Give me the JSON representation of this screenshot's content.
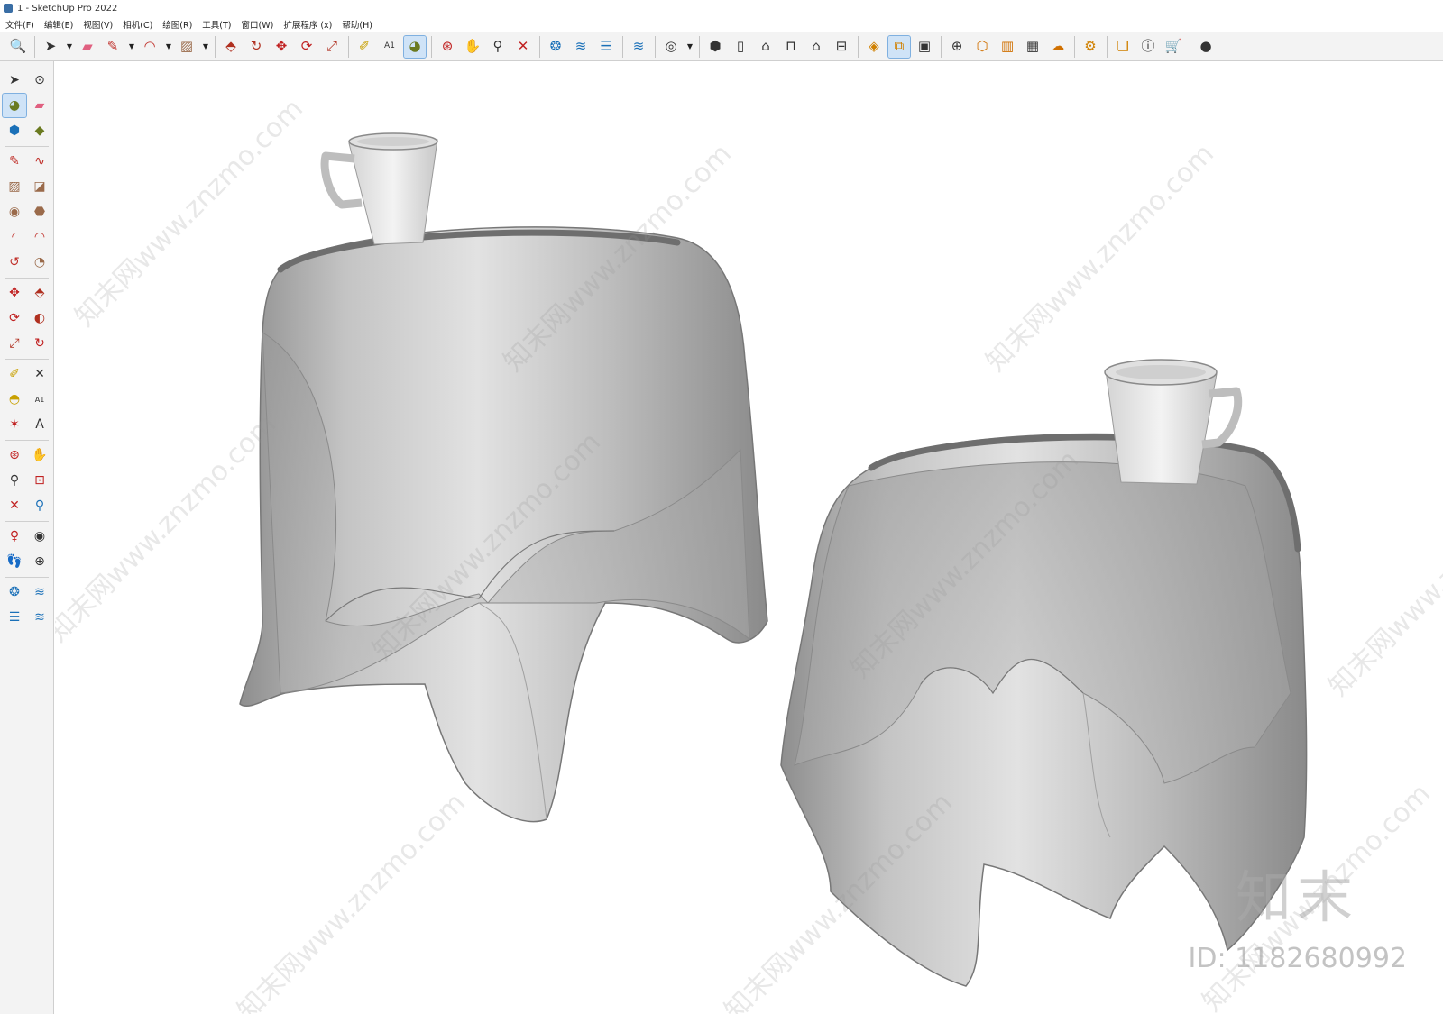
{
  "window": {
    "title": "1 - SketchUp Pro 2022"
  },
  "menu": [
    "文件(F)",
    "编辑(E)",
    "视图(V)",
    "相机(C)",
    "绘图(R)",
    "工具(T)",
    "窗口(W)",
    "扩展程序 (x)",
    "帮助(H)"
  ],
  "toolbar": {
    "icons": [
      "zoom-window-icon",
      "select-icon",
      "eraser-icon",
      "pencil-line-icon",
      "arc-icon",
      "rectangle-icon",
      "push-pull-icon",
      "follow-me-icon",
      "move-icon",
      "rotate-icon",
      "scale-icon",
      "tape-measure-icon",
      "text-label-icon",
      "paint-bucket-icon",
      "orbit-icon",
      "pan-icon",
      "zoom-icon",
      "zoom-extents-icon",
      "3d-warehouse-icon",
      "model-info-icon",
      "layers-icon",
      "components-icon",
      "account-icon",
      "iso-view-icon",
      "front-view-icon",
      "top-view-icon",
      "right-view-icon",
      "back-view-icon",
      "left-view-icon",
      "section-plane-icon",
      "section-fill-icon",
      "section-display-icon",
      "add-location-icon",
      "geo-icon",
      "shadows-icon",
      "xray-icon",
      "cloud-icon",
      "extensions-icon",
      "chat-icon",
      "info-icon",
      "cart-icon",
      "user-icon"
    ]
  },
  "left_toolbar": {
    "icons": [
      "select-icon",
      "orbit-icon",
      "paint-bucket-icon",
      "eraser-icon",
      "component-icon",
      "tag-icon",
      "pencil-icon",
      "freehand-icon",
      "rectangle-icon",
      "rotated-rectangle-icon",
      "circle-icon",
      "polygon-icon",
      "arc-icon",
      "two-point-arc-icon",
      "three-point-arc-icon",
      "pie-icon",
      "move-icon",
      "push-pull-icon",
      "rotate-icon",
      "follow-me-icon",
      "scale-icon",
      "offset-icon",
      "tape-measure-icon",
      "dimension-icon",
      "protractor-icon",
      "text-icon",
      "axes-icon",
      "3d-text-icon",
      "orbit-icon",
      "pan-icon",
      "zoom-icon",
      "zoom-window-icon",
      "zoom-extents-icon",
      "previous-view-icon",
      "position-camera-icon",
      "look-around-icon",
      "walk-icon",
      "section-plane-icon",
      "warehouse-icon",
      "extension-warehouse-icon",
      "layers-icon",
      "share-icon"
    ]
  },
  "watermark": {
    "text": "知末网www.znzmo.com",
    "brand": "知末",
    "id_label": "ID: 1182680992"
  },
  "colors": {
    "cloth": "#cfcfcf",
    "cloth_dark": "#8c8c8c",
    "cup": "#e9e9e9",
    "viewport_bg": "#ffffff",
    "active_tool": "#cfe3f7"
  }
}
